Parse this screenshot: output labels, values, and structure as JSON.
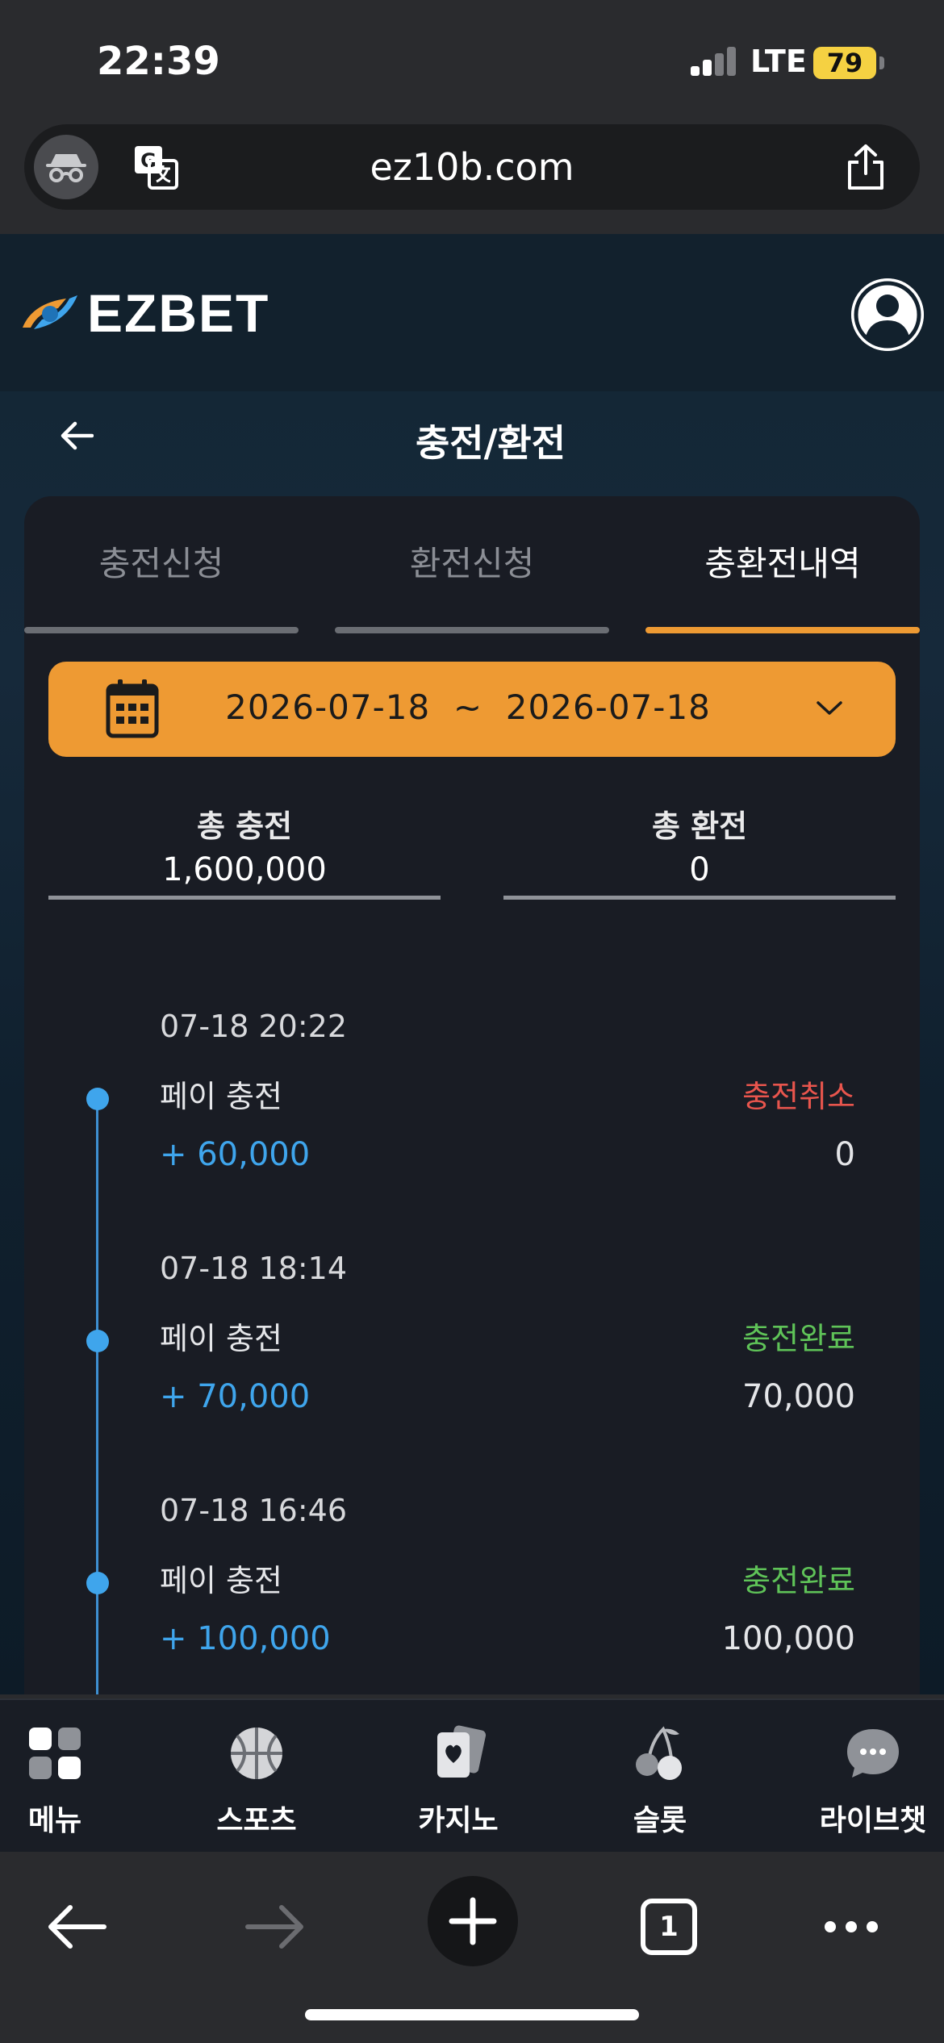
{
  "status_bar": {
    "time": "22:39",
    "network": "LTE",
    "battery": "79"
  },
  "browser": {
    "url": "ez10b.com",
    "open_tabs": "1"
  },
  "site": {
    "logo_text": "EZBET"
  },
  "page": {
    "title": "충전/환전"
  },
  "tabs": [
    {
      "label": "충전신청",
      "active": false
    },
    {
      "label": "환전신청",
      "active": false
    },
    {
      "label": "충환전내역",
      "active": true
    }
  ],
  "date_filter": {
    "start": "2026-07-18",
    "separator": "~",
    "end": "2026-07-18"
  },
  "totals": {
    "charge_label": "총 충전",
    "charge_value": "1,600,000",
    "withdraw_label": "총 환전",
    "withdraw_value": "0"
  },
  "transactions": [
    {
      "time": "07-18 20:22",
      "type": "페이 충전",
      "status": "충전취소",
      "status_kind": "cancel",
      "amount": "+ 60,000",
      "result": "0"
    },
    {
      "time": "07-18 18:14",
      "type": "페이 충전",
      "status": "충전완료",
      "status_kind": "done",
      "amount": "+ 70,000",
      "result": "70,000"
    },
    {
      "time": "07-18 16:46",
      "type": "페이 충전",
      "status": "충전완료",
      "status_kind": "done",
      "amount": "+ 100,000",
      "result": "100,000"
    }
  ],
  "bottom_nav": [
    {
      "label": "메뉴",
      "icon": "menu-grid-icon"
    },
    {
      "label": "스포츠",
      "icon": "basketball-icon"
    },
    {
      "label": "카지노",
      "icon": "cards-icon"
    },
    {
      "label": "슬롯",
      "icon": "cherry-icon"
    },
    {
      "label": "라이브챗",
      "icon": "chat-bubble-icon"
    }
  ],
  "colors": {
    "accent": "#ee9a33",
    "cancel": "#e8554d",
    "done": "#5fc358",
    "amount": "#3fa5ec",
    "panel": "#191c24"
  }
}
